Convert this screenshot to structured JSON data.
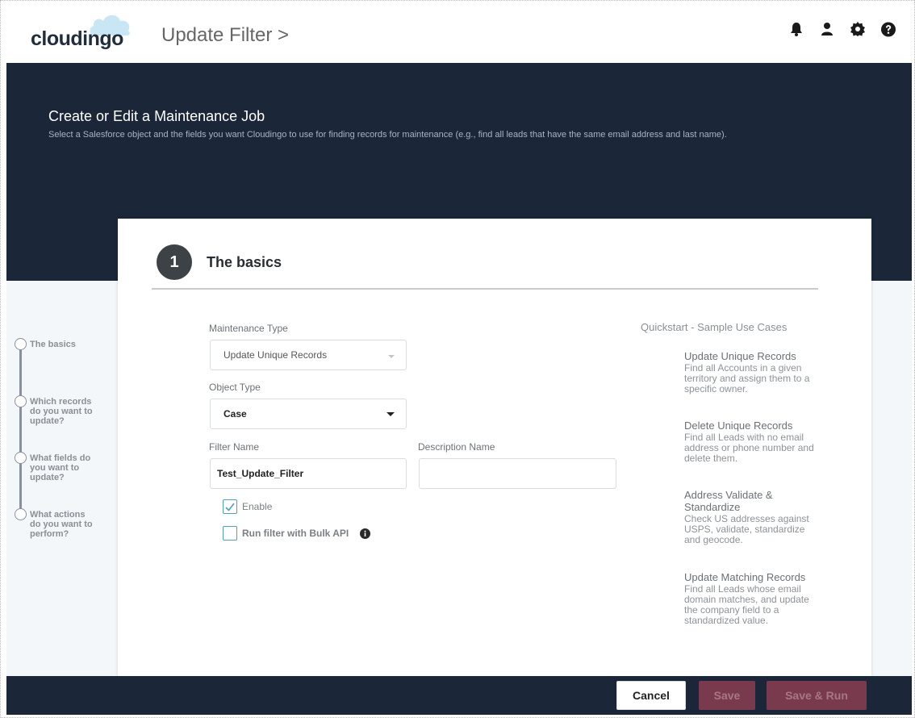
{
  "header": {
    "logo_cloud": "cloud",
    "logo_ingo": "ingo",
    "breadcrumb": "Update Filter >",
    "icons": [
      "bell-icon",
      "user-icon",
      "gear-icon",
      "help-icon"
    ]
  },
  "hero": {
    "title": "Create or Edit a Maintenance Job",
    "subtitle": "Select a Salesforce object and the fields you want Cloudingo to use for finding records for maintenance (e.g., find all leads that have the same email address and last name)."
  },
  "stepper": {
    "steps": [
      {
        "label": "The basics"
      },
      {
        "label": "Which records do you want to update?"
      },
      {
        "label": "What fields do you want to update?"
      },
      {
        "label": "What actions do you want to perform?"
      }
    ]
  },
  "section": {
    "number": "1",
    "title": "The basics"
  },
  "form": {
    "maintenance_type_label": "Maintenance Type",
    "maintenance_type_value": "Update Unique Records",
    "object_type_label": "Object Type",
    "object_type_value": "Case",
    "filter_name_label": "Filter Name",
    "filter_name_value": "Test_Update_Filter",
    "description_name_label": "Description Name",
    "description_name_value": "",
    "enable_label": "Enable",
    "enable_checked": true,
    "bulk_label": "Run filter with Bulk API",
    "bulk_checked": false
  },
  "quickstart": {
    "heading": "Quickstart - Sample Use Cases",
    "items": [
      {
        "title": "Update Unique Records",
        "desc": "Find all Accounts in a given territory and assign them to a specific owner."
      },
      {
        "title": "Delete Unique Records",
        "desc": "Find all Leads with no email address or phone number and delete them."
      },
      {
        "title": "Address Validate & Standardize",
        "desc": "Check US addresses against USPS, validate, standardize and geocode."
      },
      {
        "title": "Update Matching Records",
        "desc": "Find all Leads whose email domain matches, and update the company field to a standardized value."
      }
    ]
  },
  "footer": {
    "cancel_label": "Cancel",
    "save_label": "Save",
    "save_run_label": "Save & Run"
  },
  "colors": {
    "navy": "#1b2639",
    "save_button": "#7a3a4e",
    "checkbox_accent": "#4ea0bd"
  }
}
